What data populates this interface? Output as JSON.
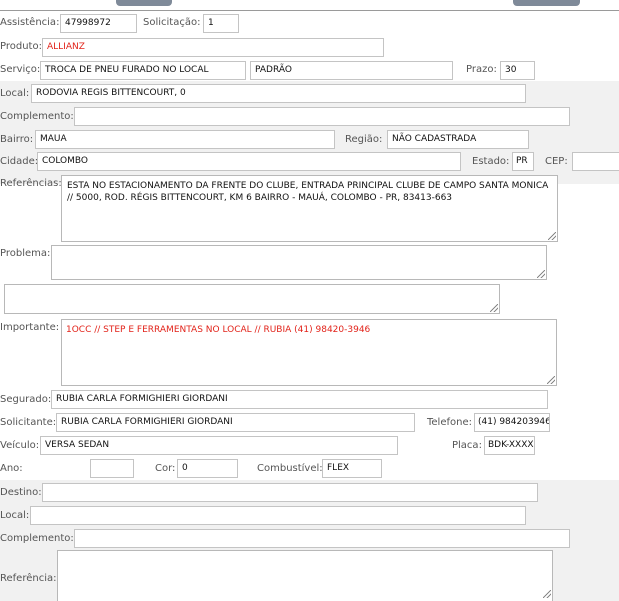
{
  "assistencia": {
    "label": "Assistência:",
    "value": "47998972"
  },
  "solicitacao": {
    "label": "Solicitação:",
    "value": "1"
  },
  "produto": {
    "label": "Produto:",
    "value": "ALLIANZ"
  },
  "servico": {
    "label": "Serviço:",
    "value": "TROCA DE PNEU FURADO NO LOCAL",
    "tipo": "PADRÃO"
  },
  "prazo": {
    "label": "Prazo:",
    "value": "30"
  },
  "local": {
    "label": "Local:",
    "value": "RODOVIA REGIS BITTENCOURT, 0"
  },
  "complemento": {
    "label": "Complemento:",
    "value": ""
  },
  "bairro": {
    "label": "Bairro:",
    "value": "MAUA"
  },
  "regiao": {
    "label": "Região:",
    "value": "NÃO CADASTRADA"
  },
  "cidade": {
    "label": "Cidade:",
    "value": "COLOMBO"
  },
  "estado": {
    "label": "Estado:",
    "value": "PR"
  },
  "cep": {
    "label": "CEP:",
    "value": ""
  },
  "referencias": {
    "label": "Referências:",
    "value": "ESTA NO ESTACIONAMENTO DA FRENTE DO CLUBE, ENTRADA PRINCIPAL CLUBE DE CAMPO SANTA MONICA // 5000, ROD. RÉGIS BITTENCOURT, KM 6 BAIRRO - MAUÁ, COLOMBO - PR, 83413-663"
  },
  "problema": {
    "label": "Problema:",
    "value": "",
    "extra_value": ""
  },
  "importante": {
    "label": "Importante:",
    "value": "1OCC // STEP E FERRAMENTAS NO LOCAL // RUBIA  (41) 98420-3946"
  },
  "segurado": {
    "label": "Segurado:",
    "value": "RUBIA CARLA FORMIGHIERI GIORDANI"
  },
  "solicitante": {
    "label": "Solicitante:",
    "value": "RUBIA CARLA FORMIGHIERI GIORDANI"
  },
  "telefone": {
    "label": "Telefone:",
    "value": "(41) 984203946"
  },
  "veiculo": {
    "label": "Veículo:",
    "value": "VERSA SEDAN"
  },
  "placa": {
    "label": "Placa:",
    "value": "BDK-XXXX"
  },
  "ano": {
    "label": "Ano:",
    "value": ""
  },
  "cor": {
    "label": "Cor:",
    "value": "0"
  },
  "combustivel": {
    "label": "Combustível:",
    "value": "FLEX"
  },
  "destino": {
    "label": "Destino:",
    "value": ""
  },
  "destino_local": {
    "label": "Local:",
    "value": ""
  },
  "destino_complemento": {
    "label": "Complemento:",
    "value": ""
  },
  "referencia": {
    "label": "Referência:",
    "value": ""
  },
  "colors": {
    "accent_red": "#e2231a",
    "band_gray": "#f1f1f1",
    "button_gray": "#7f8a99"
  }
}
